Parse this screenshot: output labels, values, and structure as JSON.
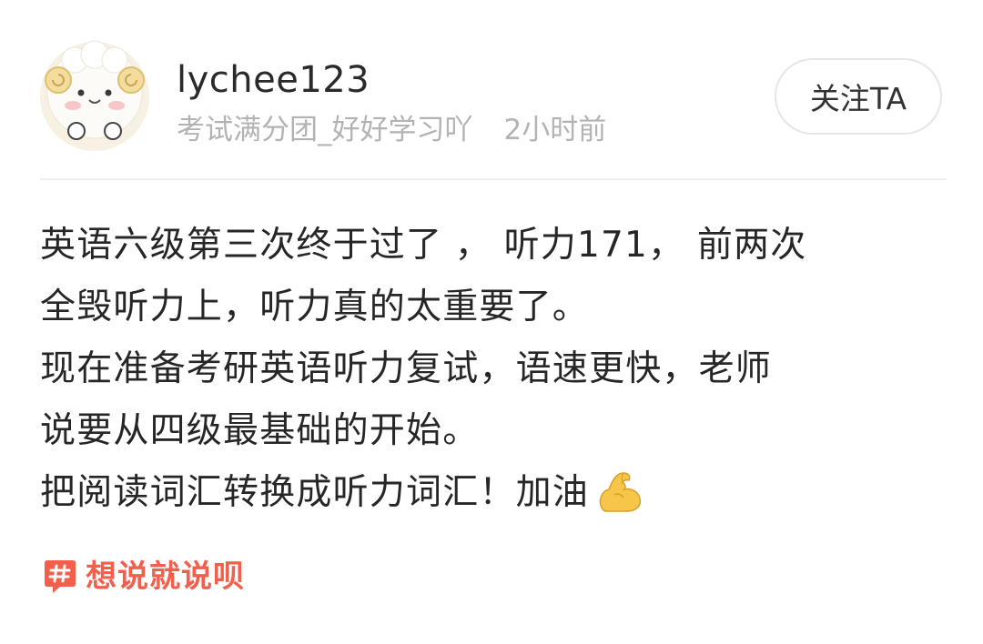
{
  "author": {
    "username": "lychee123",
    "group": "考试满分团_好好学习吖",
    "time": "2小时前",
    "avatar_icon": "sheep-avatar-icon"
  },
  "follow_button": {
    "label": "关注TA"
  },
  "post": {
    "lines": [
      "英语六级第三次终于过了 ， 听力171， 前两次",
      "全毁听力上，听力真的太重要了。",
      "现在准备考研英语听力复试，语速更快，老师",
      "说要从四级最基础的开始。",
      "把阅读词汇转换成听力词汇！加油"
    ],
    "emoji_icon": "flexed-biceps-icon"
  },
  "topic": {
    "label": "想说就说呗",
    "icon": "hashtag-icon",
    "color": "#f2604d"
  }
}
